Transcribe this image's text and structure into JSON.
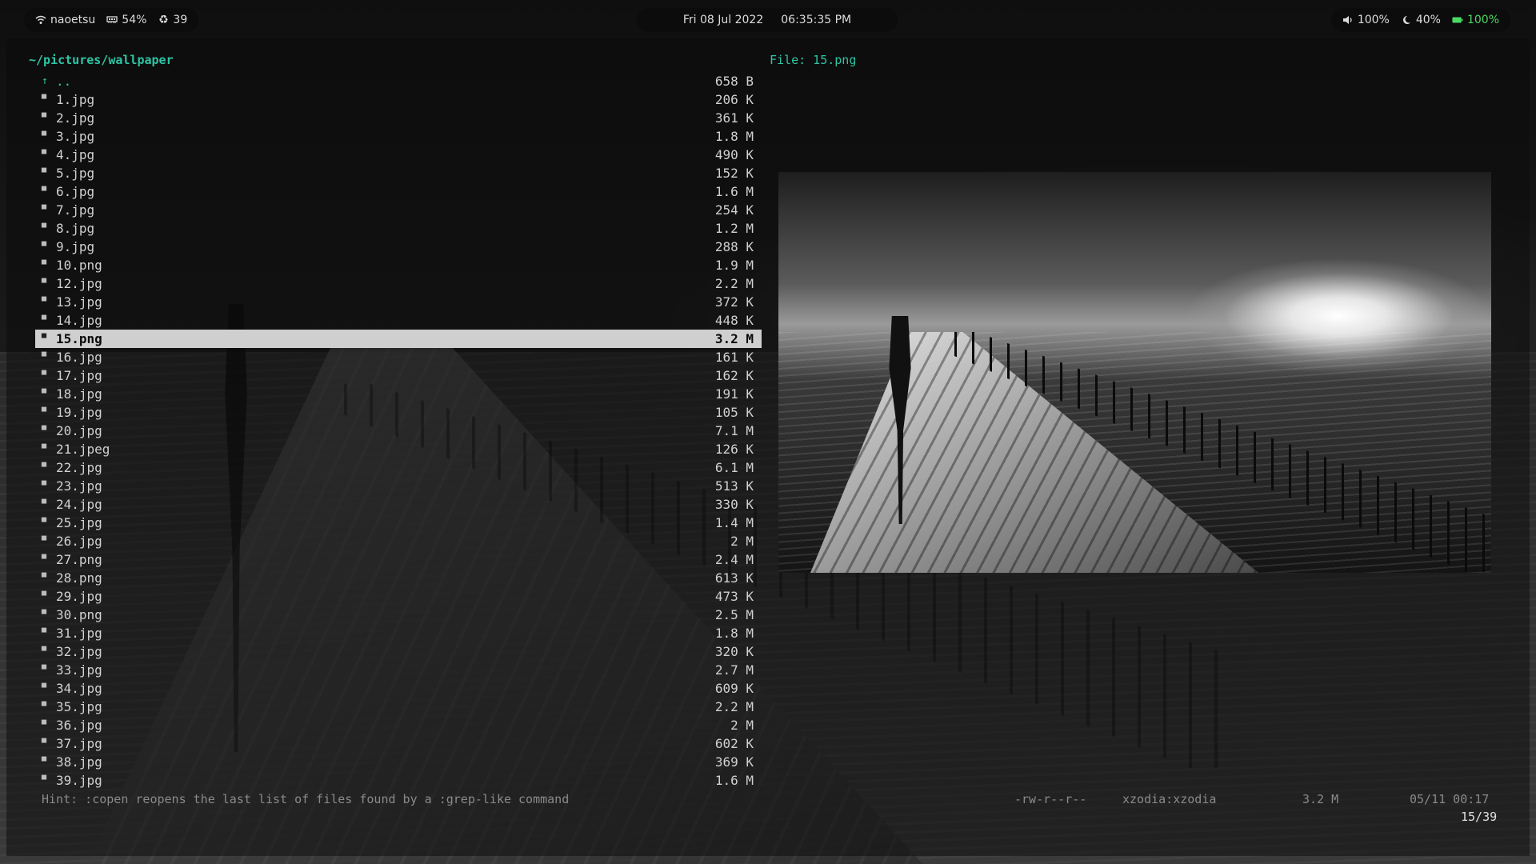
{
  "topbar": {
    "left": {
      "wifi_icon": "wifi-icon",
      "network": "naoetsu",
      "memory_icon": "memory-icon",
      "memory": "54%",
      "updates_icon": "recycle-icon",
      "updates": "39"
    },
    "center": {
      "date": "Fri 08 Jul 2022",
      "time": "06:35:35 PM"
    },
    "right": {
      "volume_icon": "speaker-icon",
      "volume": "100%",
      "brightness_icon": "moon-icon",
      "brightness": "40%",
      "battery_icon": "battery-icon",
      "battery": "100%",
      "battery_color": "#4cd964"
    }
  },
  "file_manager": {
    "path": "~/pictures/wallpaper",
    "preview_label": "File: 15.png",
    "accent_color": "#2ec4a5",
    "selected_index": 14,
    "files": [
      {
        "name": "..",
        "size": "658 B",
        "icon": "up-arrow-icon"
      },
      {
        "name": "1.jpg",
        "size": "206 K",
        "icon": "image-file-icon"
      },
      {
        "name": "2.jpg",
        "size": "361 K",
        "icon": "image-file-icon"
      },
      {
        "name": "3.jpg",
        "size": "1.8 M",
        "icon": "image-file-icon"
      },
      {
        "name": "4.jpg",
        "size": "490 K",
        "icon": "image-file-icon"
      },
      {
        "name": "5.jpg",
        "size": "152 K",
        "icon": "image-file-icon"
      },
      {
        "name": "6.jpg",
        "size": "1.6 M",
        "icon": "image-file-icon"
      },
      {
        "name": "7.jpg",
        "size": "254 K",
        "icon": "image-file-icon"
      },
      {
        "name": "8.jpg",
        "size": "1.2 M",
        "icon": "image-file-icon"
      },
      {
        "name": "9.jpg",
        "size": "288 K",
        "icon": "image-file-icon"
      },
      {
        "name": "10.png",
        "size": "1.9 M",
        "icon": "image-file-icon"
      },
      {
        "name": "12.jpg",
        "size": "2.2 M",
        "icon": "image-file-icon"
      },
      {
        "name": "13.jpg",
        "size": "372 K",
        "icon": "image-file-icon"
      },
      {
        "name": "14.jpg",
        "size": "448 K",
        "icon": "image-file-icon"
      },
      {
        "name": "15.png",
        "size": "3.2 M",
        "icon": "image-file-icon"
      },
      {
        "name": "16.jpg",
        "size": "161 K",
        "icon": "image-file-icon"
      },
      {
        "name": "17.jpg",
        "size": "162 K",
        "icon": "image-file-icon"
      },
      {
        "name": "18.jpg",
        "size": "191 K",
        "icon": "image-file-icon"
      },
      {
        "name": "19.jpg",
        "size": "105 K",
        "icon": "image-file-icon"
      },
      {
        "name": "20.jpg",
        "size": "7.1 M",
        "icon": "image-file-icon"
      },
      {
        "name": "21.jpeg",
        "size": "126 K",
        "icon": "image-file-icon"
      },
      {
        "name": "22.jpg",
        "size": "6.1 M",
        "icon": "image-file-icon"
      },
      {
        "name": "23.jpg",
        "size": "513 K",
        "icon": "image-file-icon"
      },
      {
        "name": "24.jpg",
        "size": "330 K",
        "icon": "image-file-icon"
      },
      {
        "name": "25.jpg",
        "size": "1.4 M",
        "icon": "image-file-icon"
      },
      {
        "name": "26.jpg",
        "size": "2 M",
        "icon": "image-file-icon"
      },
      {
        "name": "27.png",
        "size": "2.4 M",
        "icon": "image-file-icon"
      },
      {
        "name": "28.png",
        "size": "613 K",
        "icon": "image-file-icon"
      },
      {
        "name": "29.jpg",
        "size": "473 K",
        "icon": "image-file-icon"
      },
      {
        "name": "30.png",
        "size": "2.5 M",
        "icon": "image-file-icon"
      },
      {
        "name": "31.jpg",
        "size": "1.8 M",
        "icon": "image-file-icon"
      },
      {
        "name": "32.jpg",
        "size": "320 K",
        "icon": "image-file-icon"
      },
      {
        "name": "33.jpg",
        "size": "2.7 M",
        "icon": "image-file-icon"
      },
      {
        "name": "34.jpg",
        "size": "609 K",
        "icon": "image-file-icon"
      },
      {
        "name": "35.jpg",
        "size": "2.2 M",
        "icon": "image-file-icon"
      },
      {
        "name": "36.jpg",
        "size": "2 M",
        "icon": "image-file-icon"
      },
      {
        "name": "37.jpg",
        "size": "602 K",
        "icon": "image-file-icon"
      },
      {
        "name": "38.jpg",
        "size": "369 K",
        "icon": "image-file-icon"
      },
      {
        "name": "39.jpg",
        "size": "1.6 M",
        "icon": "image-file-icon"
      }
    ],
    "hint": "Hint: :copen reopens the last list of files found by a :grep-like command",
    "status": {
      "permissions": "-rw-r--r--",
      "owner": "xzodia:xzodia",
      "size": "3.2 M",
      "modified": "05/11 00:17",
      "position": "15/39"
    }
  }
}
